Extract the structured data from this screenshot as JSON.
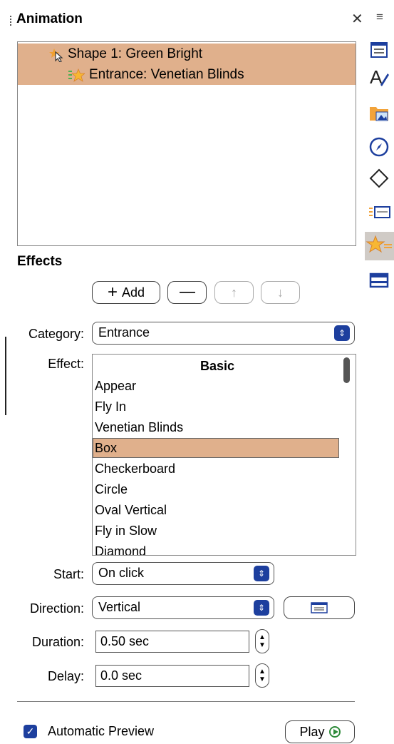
{
  "panel": {
    "title": "Animation"
  },
  "animation_list": {
    "items": [
      {
        "label": "Shape 1: Green Bright"
      },
      {
        "label": "Entrance: Venetian Blinds"
      }
    ]
  },
  "effects": {
    "section_label": "Effects",
    "add_label": "Add",
    "category_label": "Category:",
    "category_value": "Entrance",
    "effect_label": "Effect:",
    "effect_group": "Basic",
    "effect_items": [
      "Appear",
      "Fly In",
      "Venetian Blinds",
      "Box",
      "Checkerboard",
      "Circle",
      "Oval Vertical",
      "Fly in Slow",
      "Diamond"
    ],
    "selected_effect": "Venetian Blinds",
    "start_label": "Start:",
    "start_value": "On click",
    "direction_label": "Direction:",
    "direction_value": "Vertical",
    "duration_label": "Duration:",
    "duration_value": "0.50 sec",
    "delay_label": "Delay:",
    "delay_value": "0.0 sec"
  },
  "footer": {
    "auto_preview_label": "Automatic Preview",
    "auto_preview_checked": true,
    "play_label": "Play"
  },
  "sidebar": {
    "tabs": [
      "properties-icon",
      "styles-icon",
      "gallery-icon",
      "navigator-icon",
      "shapes-icon",
      "slide-transition-icon",
      "animation-icon",
      "master-slides-icon"
    ],
    "active": "animation-icon"
  },
  "colors": {
    "selection": "#e0b08c",
    "accent": "#1d3f9e",
    "play_green": "#2e8b3a"
  }
}
